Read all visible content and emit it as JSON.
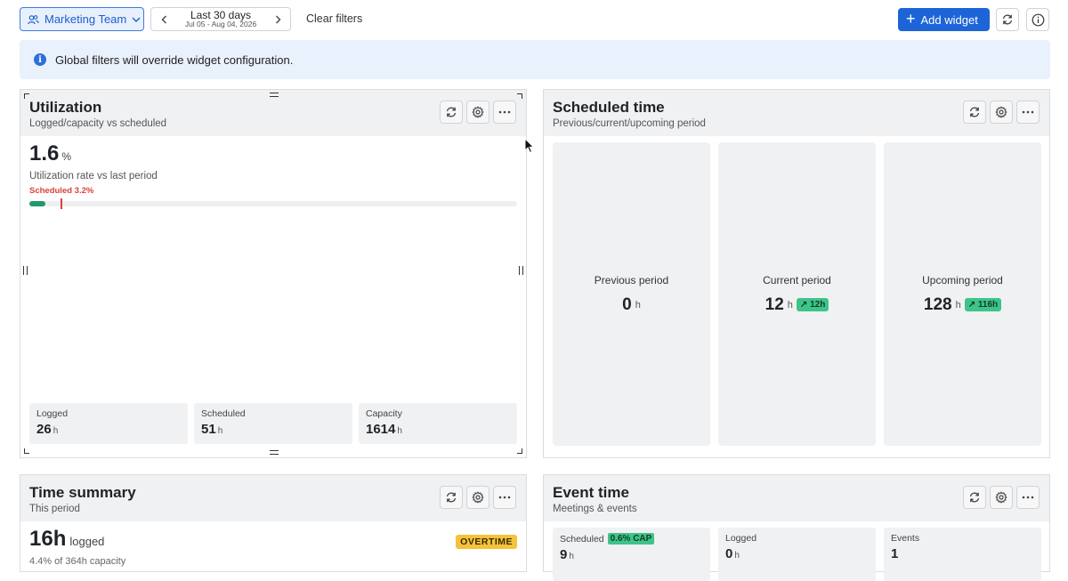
{
  "toolbar": {
    "team_label": "Marketing Team",
    "date_label": "Last 30 days",
    "date_sub": "Jul 05 - Aug 04, 2026",
    "clear_filters": "Clear filters",
    "add_widget": "Add widget"
  },
  "banner": {
    "text": "Global filters will override widget configuration."
  },
  "utilization": {
    "title": "Utilization",
    "subtitle": "Logged/capacity vs scheduled",
    "rate_value": "1.6",
    "rate_unit": "%",
    "rate_label": "Utilization rate vs last period",
    "scheduled_note": "Scheduled 3.2%",
    "logged_fraction": 0.016,
    "scheduled_fraction": 0.032,
    "stats": [
      {
        "label": "Logged",
        "value": "26",
        "unit": "h"
      },
      {
        "label": "Scheduled",
        "value": "51",
        "unit": "h"
      },
      {
        "label": "Capacity",
        "value": "1614",
        "unit": "h"
      }
    ]
  },
  "scheduled_time": {
    "title": "Scheduled time",
    "subtitle": "Previous/current/upcoming period",
    "periods": [
      {
        "label": "Previous period",
        "value": "0",
        "unit": "h",
        "badge": ""
      },
      {
        "label": "Current period",
        "value": "12",
        "unit": "h",
        "badge": "12h"
      },
      {
        "label": "Upcoming period",
        "value": "128",
        "unit": "h",
        "badge": "116h"
      }
    ]
  },
  "time_summary": {
    "title": "Time summary",
    "subtitle": "This period",
    "value": "16h",
    "value_suffix": "logged",
    "detail": "4.4% of 364h capacity",
    "badge": "OVERTIME"
  },
  "event_time": {
    "title": "Event time",
    "subtitle": "Meetings & events",
    "boxes": [
      {
        "label": "Scheduled",
        "badge": "0.6% CAP",
        "value": "9",
        "unit": "h"
      },
      {
        "label": "Logged",
        "badge": "",
        "value": "0",
        "unit": "h"
      },
      {
        "label": "Events",
        "badge": "",
        "value": "1",
        "unit": ""
      }
    ]
  },
  "icons": [
    "users-icon",
    "chevron-down-icon",
    "chevron-left-icon",
    "chevron-right-icon",
    "plus-icon",
    "refresh-icon",
    "info-icon",
    "gear-icon",
    "more-icon",
    "trend-up-icon"
  ],
  "colors": {
    "accent": "#1d64d8",
    "success": "#1e9b6a",
    "danger": "#d9423a",
    "warning": "#f5c33b"
  }
}
